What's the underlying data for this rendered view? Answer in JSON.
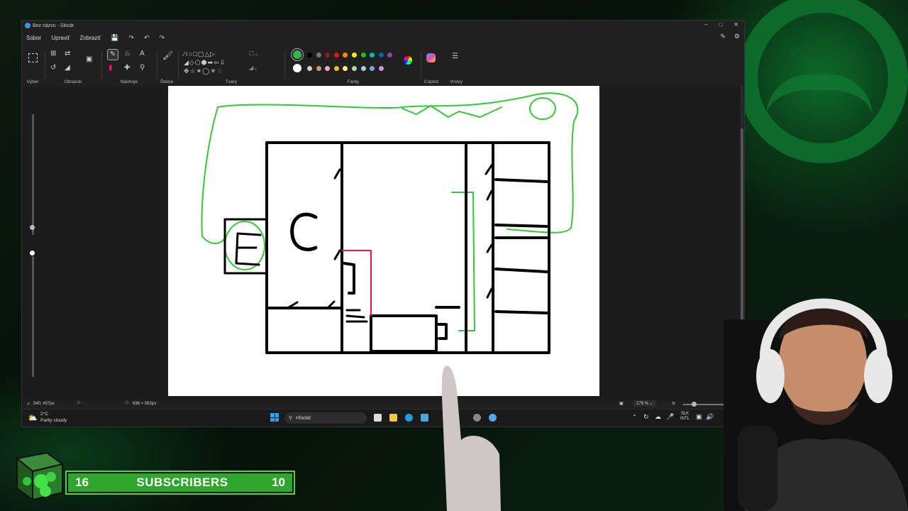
{
  "app": {
    "title": "Bez názvu - Skicár",
    "menu": [
      "Súbor",
      "Upraviť",
      "Zobraziť"
    ]
  },
  "ribbon": {
    "groups": [
      "Výber",
      "Obrázok",
      "Nástroje",
      "Štetce",
      "Tvary",
      "Farby",
      "Copilot",
      "Vrstvy"
    ],
    "accent_color": "#2fb84a"
  },
  "palette": {
    "row1": [
      "#2fb84a",
      "#000000",
      "#7a7a7a",
      "#8b1d1d",
      "#e81123",
      "#ff8c00",
      "#fff100",
      "#16c60c",
      "#00b7c3",
      "#0063b1",
      "#8e44ad"
    ],
    "row2": [
      "#ffffff",
      "#d0d0d0",
      "#c09a6b",
      "#f7a8c8",
      "#ffb900",
      "#fff59d",
      "#a6e3a1",
      "#9fd3e0",
      "#7aa6e0",
      "#c39bd3"
    ]
  },
  "status": {
    "cursor_pos": "540, 457px",
    "canvas_size": "638 × 582px",
    "zoom": "179 %"
  },
  "taskbar": {
    "weather_temp": "2°C",
    "weather_desc": "Partly cloudy",
    "search_placeholder": "Hľadať",
    "lang_top": "SLK",
    "lang_bottom": "INTL"
  },
  "overlay": {
    "subs_left": "16",
    "subs_label": "SUBSCRIBERS",
    "subs_right": "10"
  }
}
